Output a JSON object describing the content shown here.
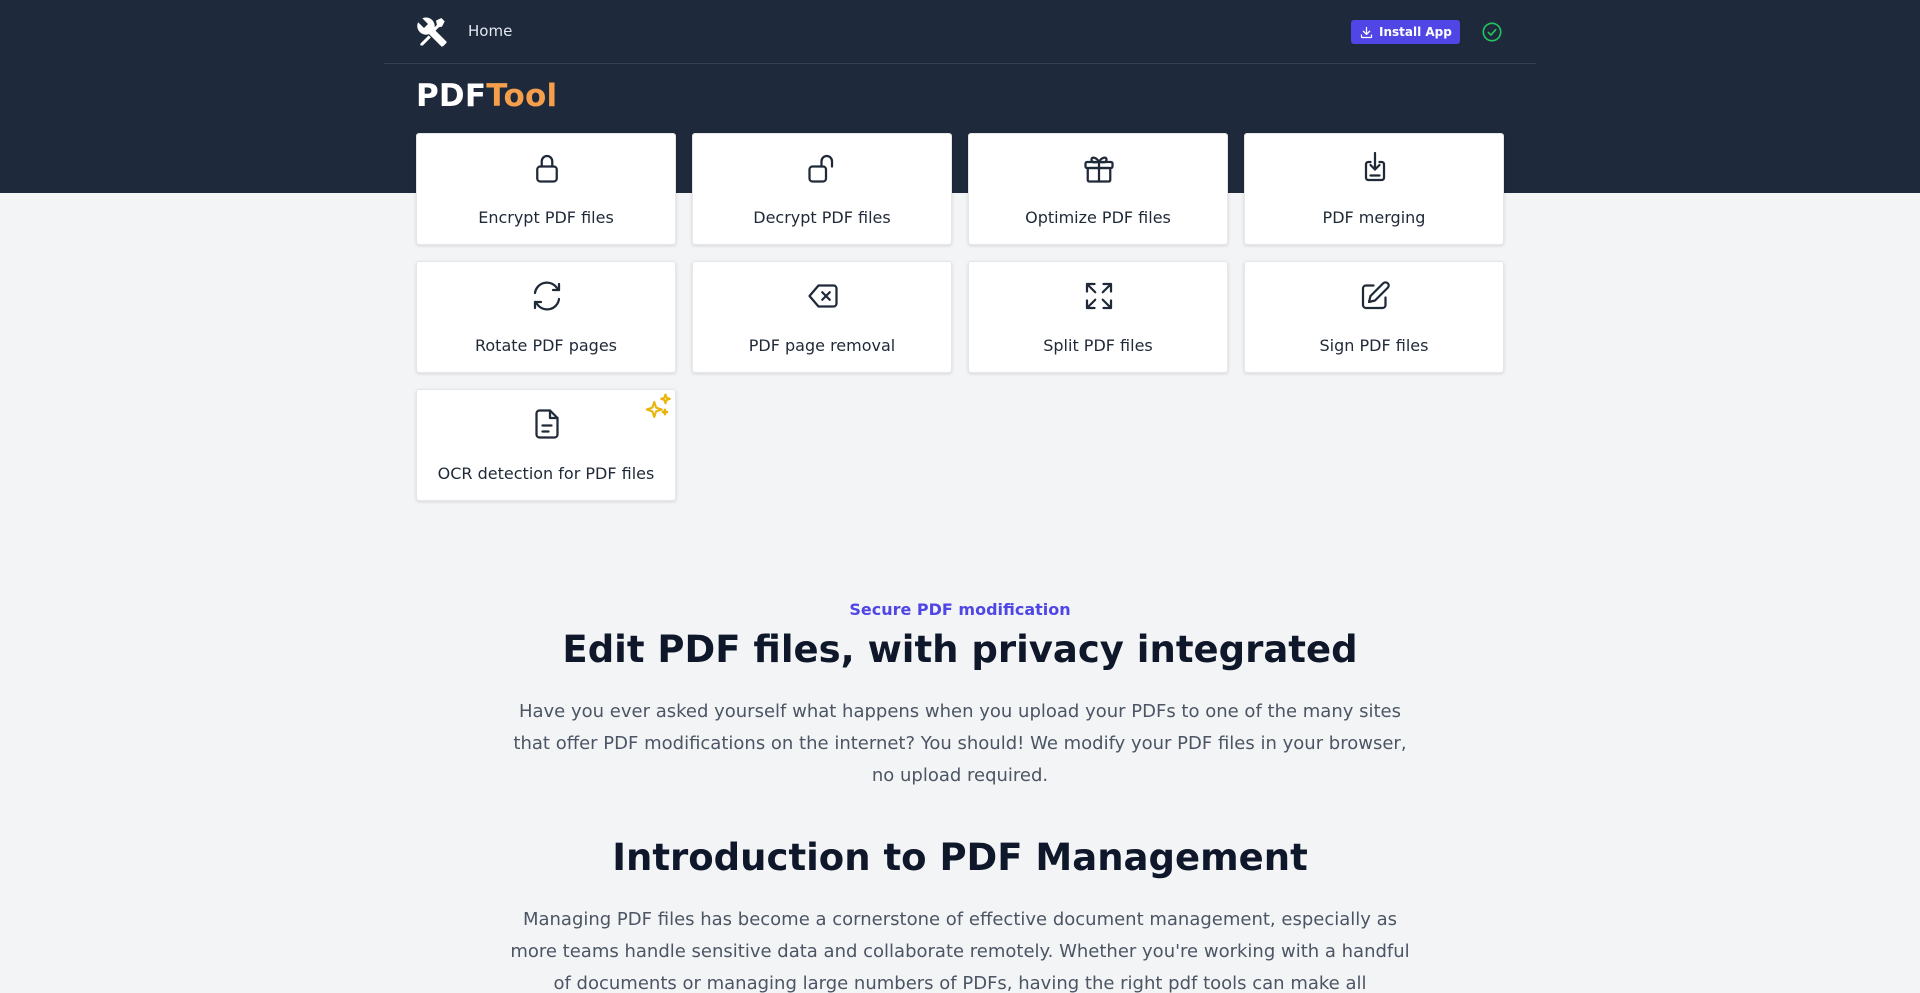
{
  "nav": {
    "home_label": "Home",
    "install_label": "Install App",
    "logo_icon": "tools-icon",
    "status_icon": "check-circle-icon"
  },
  "brand": {
    "part1": "PDF",
    "part2": "Tool"
  },
  "tools": [
    {
      "label": "Encrypt PDF files",
      "icon": "lock-icon"
    },
    {
      "label": "Decrypt PDF files",
      "icon": "unlock-icon"
    },
    {
      "label": "Optimize PDF files",
      "icon": "gift-icon"
    },
    {
      "label": "PDF merging",
      "icon": "merge-download-icon"
    },
    {
      "label": "Rotate PDF pages",
      "icon": "rotate-icon"
    },
    {
      "label": "PDF page removal",
      "icon": "backspace-icon"
    },
    {
      "label": "Split PDF files",
      "icon": "expand-arrows-icon"
    },
    {
      "label": "Sign PDF files",
      "icon": "pencil-square-icon"
    },
    {
      "label": "OCR detection for PDF files",
      "icon": "document-icon",
      "badge_icon": "sparkles-icon"
    }
  ],
  "intro": {
    "eyebrow": "Secure PDF modification",
    "heading": "Edit PDF files, with privacy integrated",
    "paragraph": "Have you ever asked yourself what happens when you upload your PDFs to one of the many sites that offer PDF modifications on the internet? You should! We modify your PDF files in your browser, no upload required."
  },
  "section": {
    "heading": "Introduction to PDF Management",
    "paragraph": "Managing PDF files has become a cornerstone of effective document management, especially as more teams handle sensitive data and collaborate remotely. Whether you're working with a handful of documents or managing large numbers of PDFs, having the right pdf tools can make all"
  },
  "colors": {
    "header_bg": "#1e293b",
    "accent": "#4f46e5",
    "brand_accent": "#f59e4b",
    "status_green": "#22c55e",
    "sparkle": "#eab308"
  }
}
